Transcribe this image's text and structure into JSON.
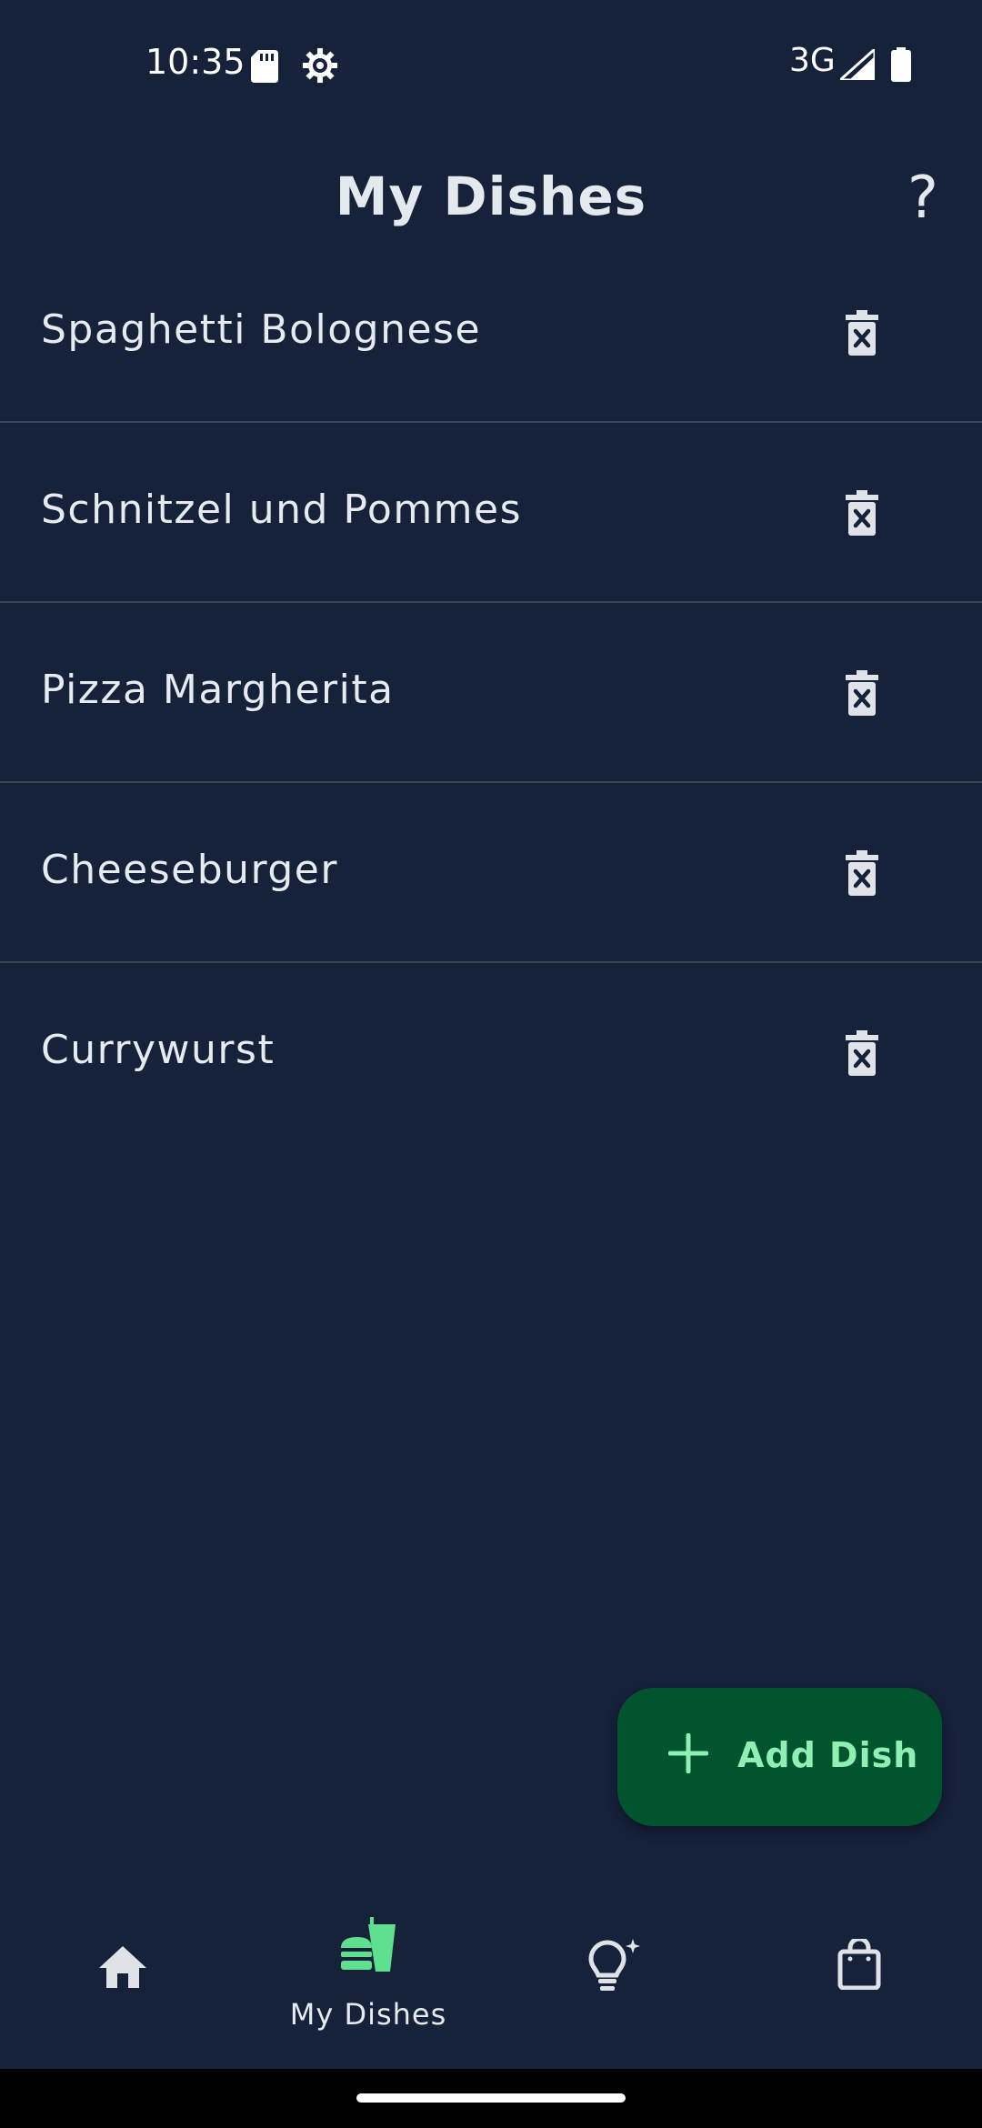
{
  "status_bar": {
    "time": "10:35",
    "network": "3G",
    "icons": [
      "sd-card-icon",
      "settings-gear-icon",
      "signal-icon",
      "battery-icon"
    ]
  },
  "header": {
    "title": "My Dishes",
    "help_label": "?"
  },
  "dishes": [
    {
      "name": "Spaghetti Bolognese",
      "action_icon": "delete-icon"
    },
    {
      "name": "Schnitzel und Pommes",
      "action_icon": "delete-icon"
    },
    {
      "name": "Pizza Margherita",
      "action_icon": "delete-icon"
    },
    {
      "name": "Cheeseburger",
      "action_icon": "delete-icon"
    },
    {
      "name": "Currywurst",
      "action_icon": "delete-icon"
    }
  ],
  "fab": {
    "label": "Add Dish",
    "icon": "plus-icon"
  },
  "bottom_nav": {
    "items": [
      {
        "icon": "home-icon",
        "label": "",
        "selected": false
      },
      {
        "icon": "dishes-icon",
        "label": "My Dishes",
        "selected": true
      },
      {
        "icon": "lightbulb-icon",
        "label": "",
        "selected": false
      },
      {
        "icon": "shopping-bag-icon",
        "label": "",
        "selected": false
      }
    ]
  },
  "colors": {
    "background": "#16213a",
    "accent": "#5fe08f",
    "fab_background": "#02542f",
    "divider": "#3b4556"
  }
}
